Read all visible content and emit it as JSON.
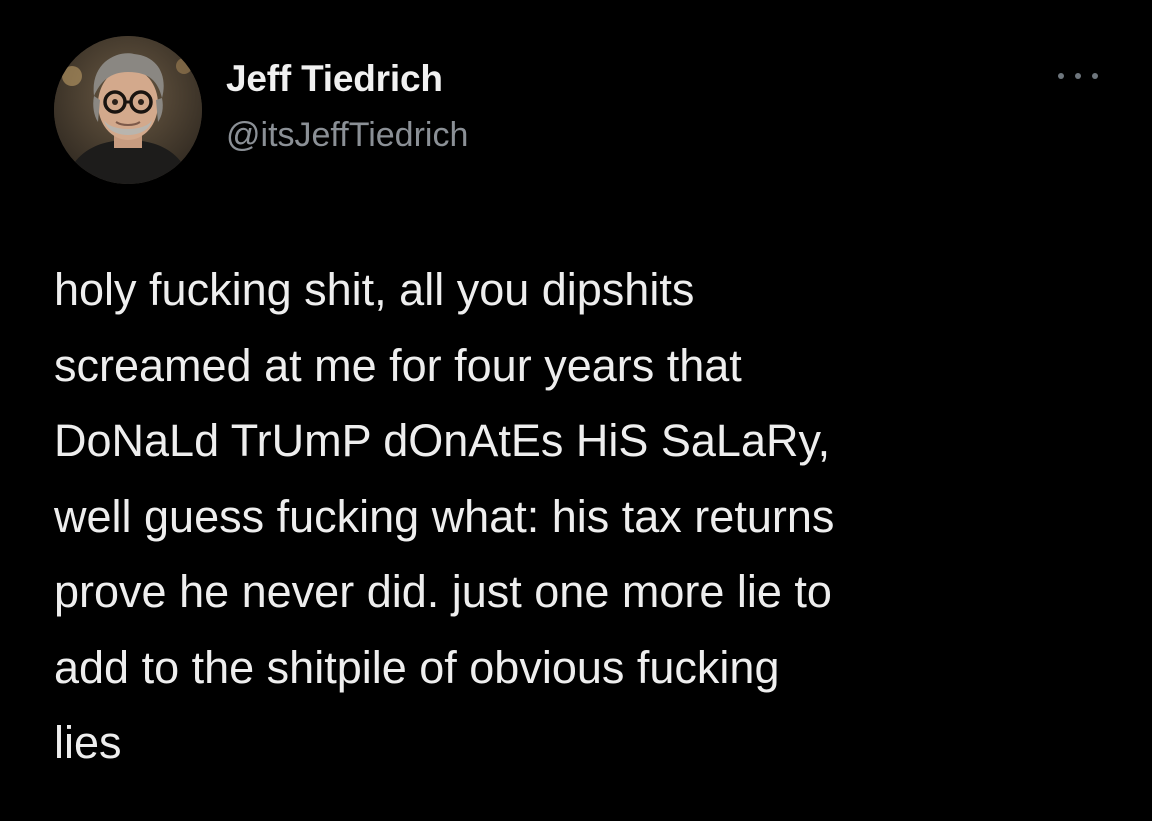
{
  "theme": {
    "background": "#000000",
    "text": "#eeeeee",
    "secondary_text": "#8b9096"
  },
  "tweet": {
    "author": {
      "display_name": "Jeff Tiedrich",
      "handle": "@itsJeffTiedrich",
      "avatar_icon": "profile-photo"
    },
    "menu_icon": "more-options-icon",
    "text_lines": [
      "holy fucking shit, all you dipshits",
      "screamed at me for four years that",
      "DoNaLd TrUmP dOnAtEs HiS SaLaRy,",
      "well guess fucking what: his tax returns",
      "prove he never did. just one more lie to",
      "add to the shitpile of obvious fucking",
      "lies"
    ]
  }
}
